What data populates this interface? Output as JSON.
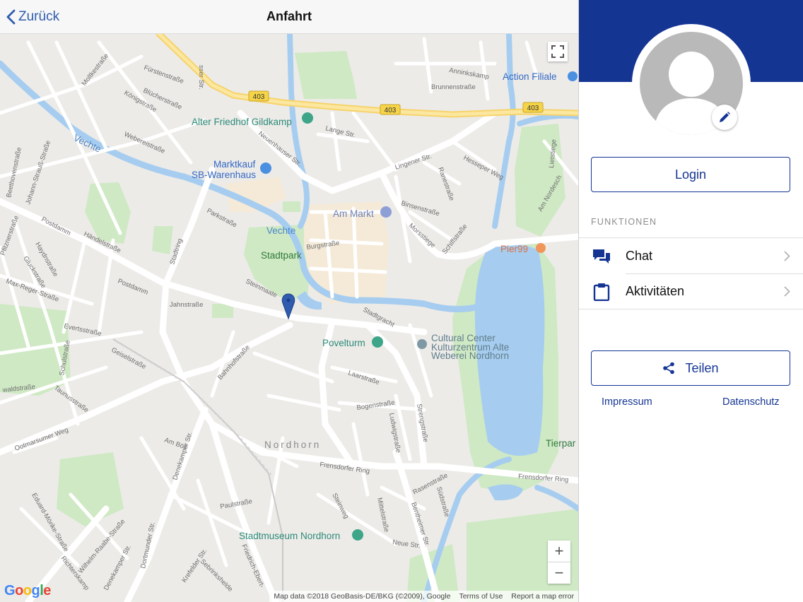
{
  "navbar": {
    "back_label": "Zurück",
    "title": "Anfahrt"
  },
  "map": {
    "road_shields": [
      "403",
      "403",
      "403"
    ],
    "places": {
      "alter_friedhof": "Alter Friedhof Gildkamp",
      "marktkauf_1": "Marktkauf",
      "marktkauf_2": "SB-Warenhaus",
      "am_markt": "Am Markt",
      "vechte_1": "Vechte",
      "vechte_2": "Vechte",
      "stadtpark": "Stadtpark",
      "action": "Action Filiale",
      "pier99": "Pier99",
      "povelturm": "Povelturm",
      "cultural_1": "Cultural Center",
      "cultural_2": "Kulturzentrum Alte",
      "cultural_3": "Weberei Nordhorn",
      "nordhorn": "Nordhorn",
      "tierpark": "Tierpar",
      "stadtmuseum": "Stadtmuseum Nordhorn"
    },
    "streets": {
      "lingener": "Lingener Str.",
      "neuenhauser": "Neuenhauser Str.",
      "postdamm1": "Postdamm",
      "postdamm2": "Postdamm",
      "jahnstrasse": "Jahnstraße",
      "stadtring": "Stadtring",
      "ootmarsumer": "Ootmarsumer Weg",
      "denekamper1": "Denekamper Str.",
      "denekamper2": "Denekamper Str.",
      "frensdorfer1": "Frensdorfer Ring",
      "frensdorfer2": "Frensdorfer Ring",
      "bentheimer": "Bentheimer Str.",
      "friedrich": "Friedrich-Ebert-",
      "richterskamp": "Richterskamp",
      "moltkestrasse": "Moltkestraße",
      "fuerstenstrasse": "Fürstenstraße",
      "bluecherstrasse": "Blücherstraße",
      "koenigstrasse": "Königstraße",
      "weberstrasse": "Webereistraße",
      "parkstrasse": "Parkstraße",
      "haendelstrasse": "Händelstraße",
      "haydnstrasse": "Haydnstraße",
      "glueckstrasse": "Gluckstraße",
      "max_reger": "Max-Reger-Straße",
      "pfitznerstrasse": "Pfitznerstraße",
      "bahnhofstrasse": "Bahnhofstraße",
      "laarstrasse": "Laarstraße",
      "bogenstrasse": "Bogenstraße",
      "stadtgracht": "Stadtgracht",
      "burgstrasse": "Burgstraße",
      "steinmaate": "Steinmaate",
      "binsenstrasse": "Binsenstraße",
      "morsstiege": "Morsstiege",
      "schiffstrasse": "Schiffstraße",
      "hesseper": "Hesseper Weg",
      "ludwigstrasse": "Ludwigstraße",
      "strengstrasse": "Strengstraße",
      "rasenstrasse": "Rasenstraße",
      "suedstrasse": "Südstraße",
      "mittelstrasse": "Mittelstraße",
      "neue_str": "Neue Str.",
      "paulstrasse": "Paulstraße",
      "am_boel": "Am Böll",
      "evertsstrasse": "Evertsstraße",
      "geiselstrasse": "Geiselstraße",
      "schulstrasse": "Schulstraße",
      "eduard": "Eduard-Mörike-Straße",
      "wilhelm": "Wilhelm-Raabe-Straße",
      "lange_str": "Lange Str.",
      "brunnenstrasse": "Brunnenstraße",
      "anninkskamp": "Anninkskamp",
      "am_nordesch": "Am Nordesch",
      "lietstiege": "Lietstiege",
      "ranestrasse": "Ranestraße",
      "steinweg": "Steinweg",
      "krefelder": "Krefelder Str.",
      "sebrinkshelde": "Sebrinkshelde",
      "dortmunder": "Dortmunder Str.",
      "beethovenstrasse": "Beethovenstraße",
      "johann": "Johann-Strauß-Straße",
      "waldstrasse": "waldstraße",
      "taunusstrasse": "Taunusstraße",
      "sser_str": "sser Str."
    },
    "footer": {
      "data": "Map data ©2018 GeoBasis-DE/BKG (©2009), Google",
      "terms": "Terms of Use",
      "report": "Report a map error"
    },
    "zoom_in": "+",
    "zoom_out": "−",
    "logo": {
      "g1": "G",
      "o1": "o",
      "o2": "o",
      "g2": "g",
      "l": "l",
      "e": "e"
    }
  },
  "sidebar": {
    "login_label": "Login",
    "section_label": "FUNKTIONEN",
    "menu": [
      {
        "label": "Chat",
        "icon": "chat-icon"
      },
      {
        "label": "Aktivitäten",
        "icon": "clipboard-icon"
      }
    ],
    "share_label": "Teilen",
    "impressum": "Impressum",
    "datenschutz": "Datenschutz"
  },
  "colors": {
    "brand": "#153593",
    "banner": "#153593",
    "link": "#153593"
  }
}
